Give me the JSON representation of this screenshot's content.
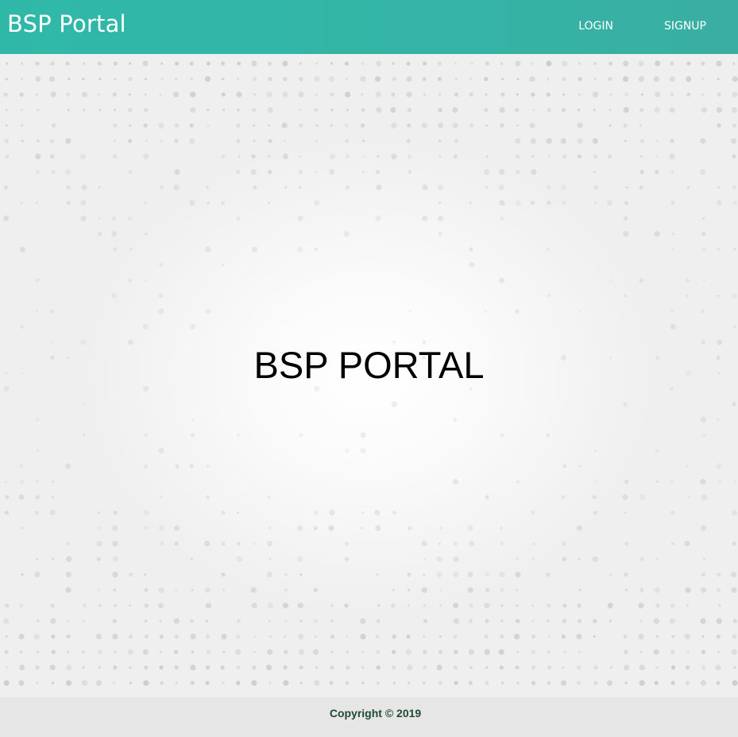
{
  "navbar": {
    "brand": "BSP Portal",
    "links": [
      {
        "label": "LOGIN"
      },
      {
        "label": "SIGNUP"
      }
    ]
  },
  "hero": {
    "title": "BSP PORTAL"
  },
  "footer": {
    "copyright": "Copyright © 2019"
  },
  "colors": {
    "navbar_bg": "#33b5a7",
    "footer_bg": "#e6e6e6",
    "footer_text": "#1f4a33"
  }
}
